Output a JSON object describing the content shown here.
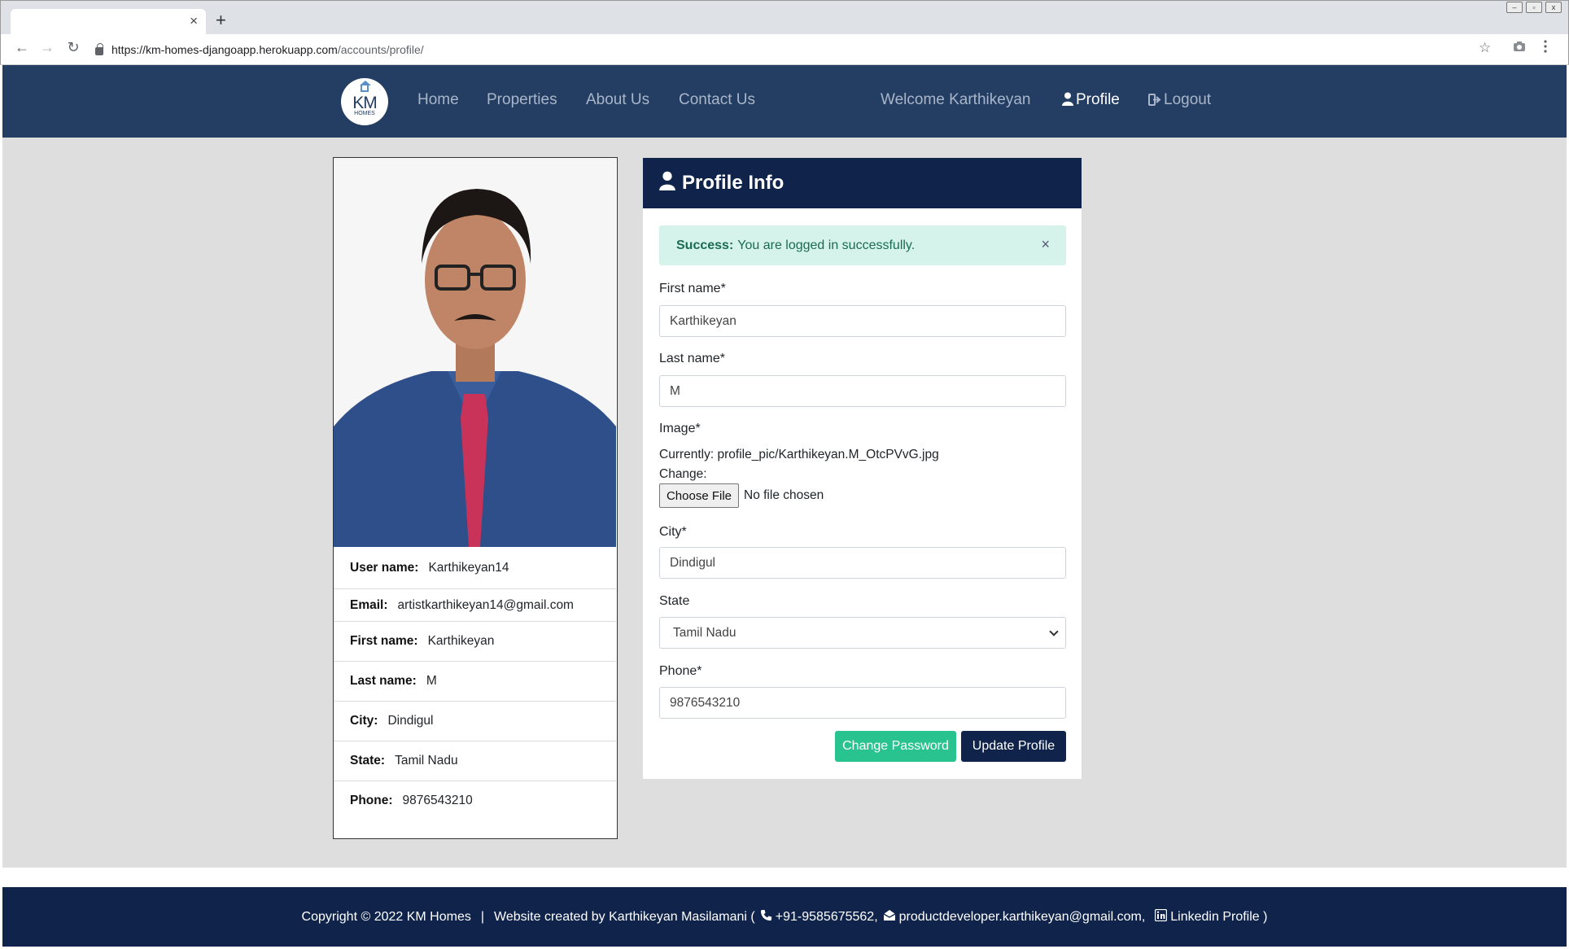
{
  "browser": {
    "tab_close": "×",
    "new_tab": "+",
    "url_host": "https://km-homes-djangoapp.herokuapp.com",
    "url_path": "/accounts/profile/",
    "back": "←",
    "forward": "→",
    "reload": "↻",
    "bookmark": "☆"
  },
  "navbar": {
    "logo_text": "KM",
    "logo_sub": "HOMES",
    "home": "Home",
    "properties": "Properties",
    "about": "About Us",
    "contact": "Contact Us",
    "welcome": "Welcome Karthikeyan",
    "profile": "Profile",
    "logout": "Logout"
  },
  "user_card": {
    "rows": [
      {
        "label": "User name:",
        "value": "Karthikeyan14"
      },
      {
        "label": "Email:",
        "value": "artistkarthikeyan14@gmail.com"
      },
      {
        "label": "First name:",
        "value": "Karthikeyan"
      },
      {
        "label": "Last name:",
        "value": "M"
      },
      {
        "label": "City:",
        "value": "Dindigul"
      },
      {
        "label": "State:",
        "value": "Tamil Nadu"
      },
      {
        "label": "Phone:",
        "value": "9876543210"
      }
    ]
  },
  "profile_form": {
    "title": "Profile Info",
    "alert_strong": "Success:",
    "alert_text": "You are logged in successfully.",
    "alert_close": "×",
    "first_name_label": "First name*",
    "first_name_value": "Karthikeyan",
    "last_name_label": "Last name*",
    "last_name_value": "M",
    "image_label": "Image*",
    "image_current": "Currently: profile_pic/Karthikeyan.M_OtcPVvG.jpg",
    "image_change": "Change:",
    "choose_file": "Choose File",
    "no_file": "No file chosen",
    "city_label": "City*",
    "city_value": "Dindigul",
    "state_label": "State",
    "state_value": "Tamil Nadu",
    "phone_label": "Phone*",
    "phone_value": "9876543210",
    "change_password": "Change Password",
    "update_profile": "Update Profile"
  },
  "footer": {
    "copyright": "Copyright © 2022 KM Homes",
    "divider": "|",
    "created_by": "Website created by Karthikeyan Masilamani (",
    "phone": "+91-9585675562,",
    "email": "productdeveloper.karthikeyan@gmail.com,",
    "linkedin": "Linkedin Profile )"
  }
}
